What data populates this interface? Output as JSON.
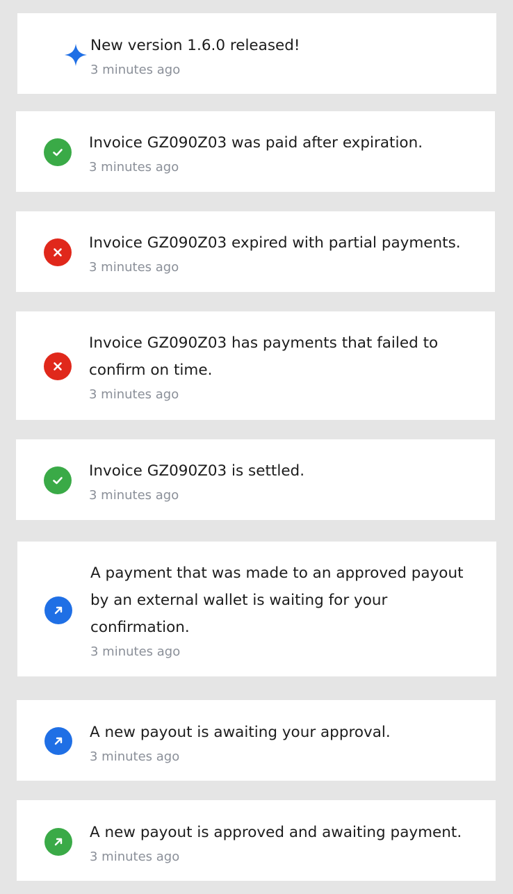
{
  "colors": {
    "background": "#e5e5e5",
    "card": "#ffffff",
    "blue": "#1f6fe5",
    "green": "#3aaa47",
    "red": "#e0281b",
    "text": "#1c1c1c",
    "muted": "#8a8f98"
  },
  "notifications": [
    {
      "icon": "sparkle-icon",
      "status": "info",
      "message": "New version 1.6.0 released!",
      "time": "3 minutes ago"
    },
    {
      "icon": "check-circle-icon",
      "status": "success",
      "message": "Invoice GZ090Z03 was paid after expiration.",
      "time": "3 minutes ago"
    },
    {
      "icon": "x-circle-icon",
      "status": "error",
      "message": "Invoice GZ090Z03 expired with partial payments.",
      "time": "3 minutes ago"
    },
    {
      "icon": "x-circle-icon",
      "status": "error",
      "message": "Invoice GZ090Z03 has payments that failed to confirm on time.",
      "time": "3 minutes ago"
    },
    {
      "icon": "check-circle-icon",
      "status": "success",
      "message": "Invoice GZ090Z03 is settled.",
      "time": "3 minutes ago"
    },
    {
      "icon": "arrow-up-right-icon",
      "status": "info",
      "message": "A payment that was made to an approved payout by an external wallet is waiting for your confirmation.",
      "time": "3 minutes ago"
    },
    {
      "icon": "arrow-up-right-icon",
      "status": "info",
      "message": "A new payout is awaiting your approval.",
      "time": "3 minutes ago"
    },
    {
      "icon": "arrow-up-right-icon",
      "status": "success",
      "message": "A new payout is approved and awaiting payment.",
      "time": "3 minutes ago"
    }
  ]
}
